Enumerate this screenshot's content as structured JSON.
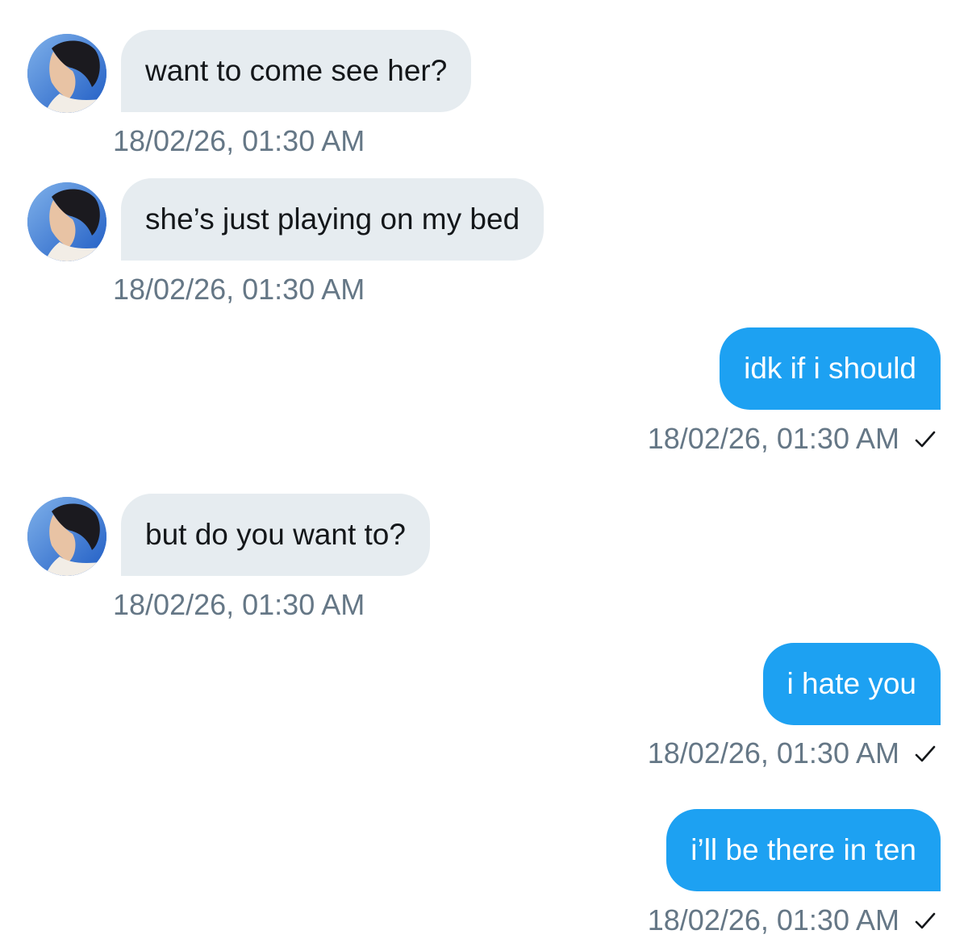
{
  "messages": [
    {
      "direction": "incoming",
      "text": "want to come see her?",
      "timestamp": "18/02/26, 01:30 AM"
    },
    {
      "direction": "incoming",
      "text": "she’s just playing on my bed",
      "timestamp": "18/02/26, 01:30 AM"
    },
    {
      "direction": "outgoing",
      "text": "idk if i should",
      "timestamp": "18/02/26, 01:30 AM",
      "status": "sent"
    },
    {
      "direction": "incoming",
      "text": "but do you want to?",
      "timestamp": "18/02/26, 01:30 AM"
    },
    {
      "direction": "outgoing",
      "text": "i hate you",
      "timestamp": "18/02/26, 01:30 AM",
      "status": "sent"
    },
    {
      "direction": "outgoing",
      "text": "i’ll be there in ten",
      "timestamp": "18/02/26, 01:30 AM",
      "status": "sent"
    }
  ],
  "colors": {
    "incoming_bubble": "#e6ecf0",
    "outgoing_bubble": "#1da1f2",
    "timestamp_text": "#657786"
  },
  "icons": {
    "read_receipt": "checkmark-icon",
    "sender_avatar": "avatar"
  }
}
